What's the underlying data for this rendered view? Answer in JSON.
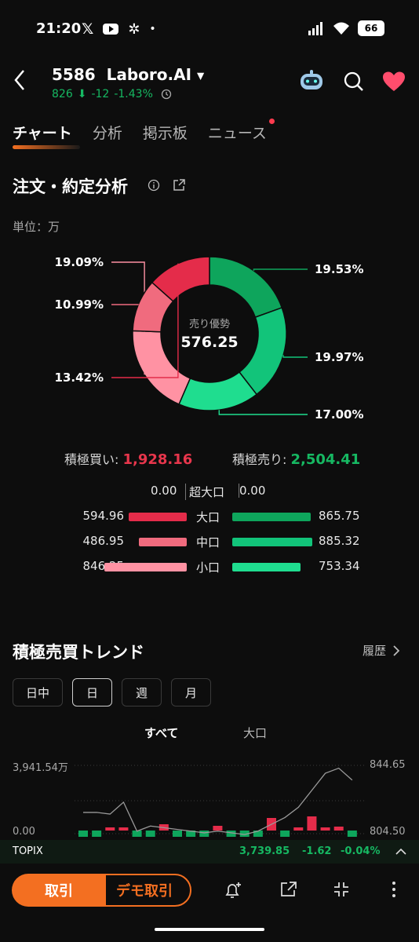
{
  "status": {
    "time": "21:20",
    "battery": "66",
    "icons": [
      "x-icon",
      "youtube-icon",
      "pinwheel-icon",
      "dot-icon",
      "signal-icon",
      "wifi-icon",
      "battery-icon"
    ]
  },
  "header": {
    "code": "5586",
    "name": "Laboro.AI",
    "price": "826",
    "change": "-12",
    "change_pct": "-1.43%"
  },
  "tabs": [
    {
      "label": "チャート",
      "active": true
    },
    {
      "label": "分析",
      "active": false
    },
    {
      "label": "掲示板",
      "active": false
    },
    {
      "label": "ニュース",
      "active": false,
      "badge": true
    }
  ],
  "order_analysis": {
    "title": "注文・約定分析",
    "unit": "単位：万",
    "center_label": "売り優勢",
    "center_value": "576.25",
    "slices": [
      {
        "label": "19.53%",
        "value": 19.53,
        "color": "#0ea55c",
        "side": "right"
      },
      {
        "label": "19.97%",
        "value": 19.97,
        "color": "#12c47a",
        "side": "right"
      },
      {
        "label": "17.00%",
        "value": 17.0,
        "color": "#1fdd8f",
        "side": "right"
      },
      {
        "label": "19.09%",
        "value": 19.09,
        "color": "#ff92a3",
        "side": "left"
      },
      {
        "label": "10.99%",
        "value": 10.99,
        "color": "#f06b7e",
        "side": "left"
      },
      {
        "label": "13.42%",
        "value": 13.42,
        "color": "#e42c4a",
        "side": "left"
      }
    ],
    "buy_label": "積極買い:",
    "buy_value": "1,928.16",
    "sell_label": "積極売り:",
    "sell_value": "2,504.41",
    "rows": [
      {
        "label": "超大口",
        "buy": "0.00",
        "sell": "0.00",
        "buy_ratio": 0,
        "sell_ratio": 0
      },
      {
        "label": "大口",
        "buy": "594.96",
        "sell": "865.75",
        "buy_ratio": 0.672,
        "sell_ratio": 0.978
      },
      {
        "label": "中口",
        "buy": "486.95",
        "sell": "885.32",
        "buy_ratio": 0.55,
        "sell_ratio": 1.0
      },
      {
        "label": "小口",
        "buy": "846.25",
        "sell": "753.34",
        "buy_ratio": 0.956,
        "sell_ratio": 0.851
      }
    ]
  },
  "trend": {
    "title": "積極売買トレンド",
    "history_label": "履歴",
    "periods": [
      {
        "label": "日中",
        "active": false
      },
      {
        "label": "日",
        "active": true
      },
      {
        "label": "週",
        "active": false
      },
      {
        "label": "月",
        "active": false
      }
    ],
    "filters": [
      {
        "label": "すべて",
        "active": true
      },
      {
        "label": "大口",
        "active": false
      }
    ],
    "left_top": "3,941.54万",
    "left_bottom": "0.00",
    "right_top": "844.65",
    "right_bottom": "804.50"
  },
  "chart_data": {
    "type": "bar",
    "title": "",
    "y_left_range": [
      0,
      3941.54
    ],
    "y_right_range": [
      804.5,
      844.65
    ],
    "bars": [
      -40,
      -40,
      20,
      20,
      -40,
      -40,
      40,
      -40,
      -40,
      -40,
      30,
      -40,
      -40,
      -40,
      80,
      -40,
      20,
      90,
      20,
      25,
      -40
    ],
    "price_line": [
      817,
      817,
      816,
      823,
      806,
      809,
      808,
      807,
      806,
      805,
      806,
      805,
      804,
      806,
      810,
      814,
      820,
      830,
      840,
      843,
      836
    ]
  },
  "topix": {
    "label": "TOPIX",
    "value": "3,739.85",
    "change": "-1.62",
    "change_pct": "-0.04%"
  },
  "bottom": {
    "trade": "取引",
    "demo": "デモ取引"
  }
}
